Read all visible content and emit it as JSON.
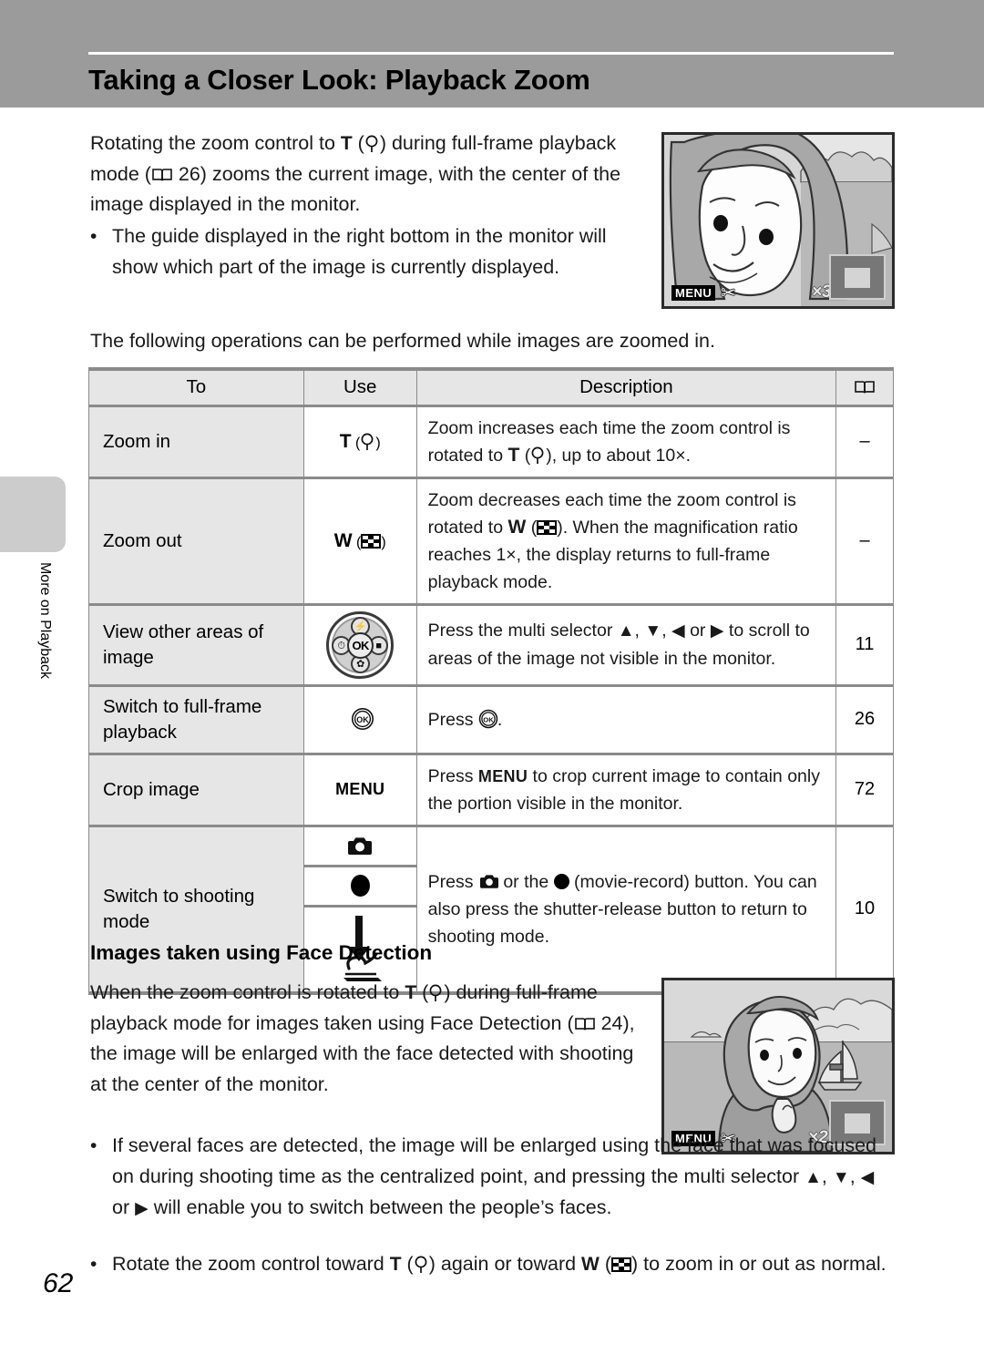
{
  "page": {
    "title": "Taking a Closer Look: Playback Zoom",
    "number": "62",
    "side_tab_label": "More on Playback"
  },
  "intro": {
    "line1_a": "Rotating the zoom control to ",
    "glyph_T": "T",
    "line1_b": " (",
    "glyph_mag": "magnifier-icon",
    "line1_c": ") during full-frame",
    "line2_a": "playback mode (",
    "glyph_book": "book-icon",
    "line2_b": " 26) zooms the current image, with",
    "line3": "the center of the image displayed in the monitor.",
    "bullet": "The guide displayed in the right bottom in the monitor will show which part of the image is currently displayed."
  },
  "ops_intro": "The following operations can be performed while images are zoomed in.",
  "table": {
    "headers": {
      "to": "To",
      "use": "Use",
      "description": "Description",
      "reference": "book-icon"
    },
    "rows": [
      {
        "to": "Zoom in",
        "use_glyph": "T (magnifier)",
        "use_letter": "T",
        "description_a": "Zoom increases each time the zoom control is rotated to ",
        "description_b": ", up to about 10×.",
        "reference": "–"
      },
      {
        "to": "Zoom out",
        "use_glyph": "W (thumbnail)",
        "use_letter": "W",
        "description_a": "Zoom decreases each time the zoom control is rotated to ",
        "description_b": ". When the magnification ratio reaches 1×, the display returns to full-frame playback mode.",
        "reference": "–"
      },
      {
        "to": "View other areas of image",
        "use_glyph": "multi-selector",
        "description_a": "Press the multi selector ",
        "description_b": " to scroll to areas of the image not visible in the monitor.",
        "reference": "11"
      },
      {
        "to": "Switch to full-frame playback",
        "use_glyph": "ok-button",
        "description_a": "Press ",
        "description_b": ".",
        "reference": "26"
      },
      {
        "to": "Crop image",
        "use_glyph": "MENU",
        "use_letter": "MENU",
        "description_a": "Press ",
        "description_b": " to crop current image to contain only the portion visible in the monitor.",
        "reference": "72"
      },
      {
        "to": "Switch to shooting mode",
        "use_glyph": "camera / movie-record / shutter-release",
        "description_a": "Press ",
        "description_b": " or the ",
        "description_c": " (movie-record) button. You can also press the shutter-release button to return to shooting mode.",
        "reference": "10"
      }
    ]
  },
  "face_detection": {
    "heading": "Images taken using Face Detection",
    "para_a": "When the zoom control is rotated to ",
    "para_b": " (",
    "para_c": ") during full-frame playback mode for images taken using Face Detection (",
    "para_d": " 24), the image will be enlarged with the face detected with shooting at the center of the monitor.",
    "bullet1_a": "If several faces are detected, the image will be enlarged using the face that was focused on during shooting time as the centralized point, and pressing the multi selector ",
    "bullet1_b": " will enable you to switch between the people’s faces.",
    "bullet2_a": "Rotate the zoom control toward ",
    "bullet2_b": " again or toward ",
    "bullet2_c": " to zoom in or out as normal."
  },
  "monitors": [
    {
      "name": "playback-zoom-monitor",
      "osd_menu": "MENU",
      "osd_scissors": "scissors-icon",
      "magnification": "×3.0",
      "guide": "navigation-guide-box"
    },
    {
      "name": "face-detection-monitor",
      "osd_menu": "MENU",
      "osd_scissors": "scissors-icon",
      "magnification": "×2.0",
      "guide": "navigation-guide-box"
    }
  ],
  "colors": {
    "header_band": "#9b9b9b",
    "table_header": "#e6e6e6",
    "table_label_cell": "#e6e6e6",
    "side_tab": "#cccccc",
    "rule": "#8a8a8a"
  }
}
